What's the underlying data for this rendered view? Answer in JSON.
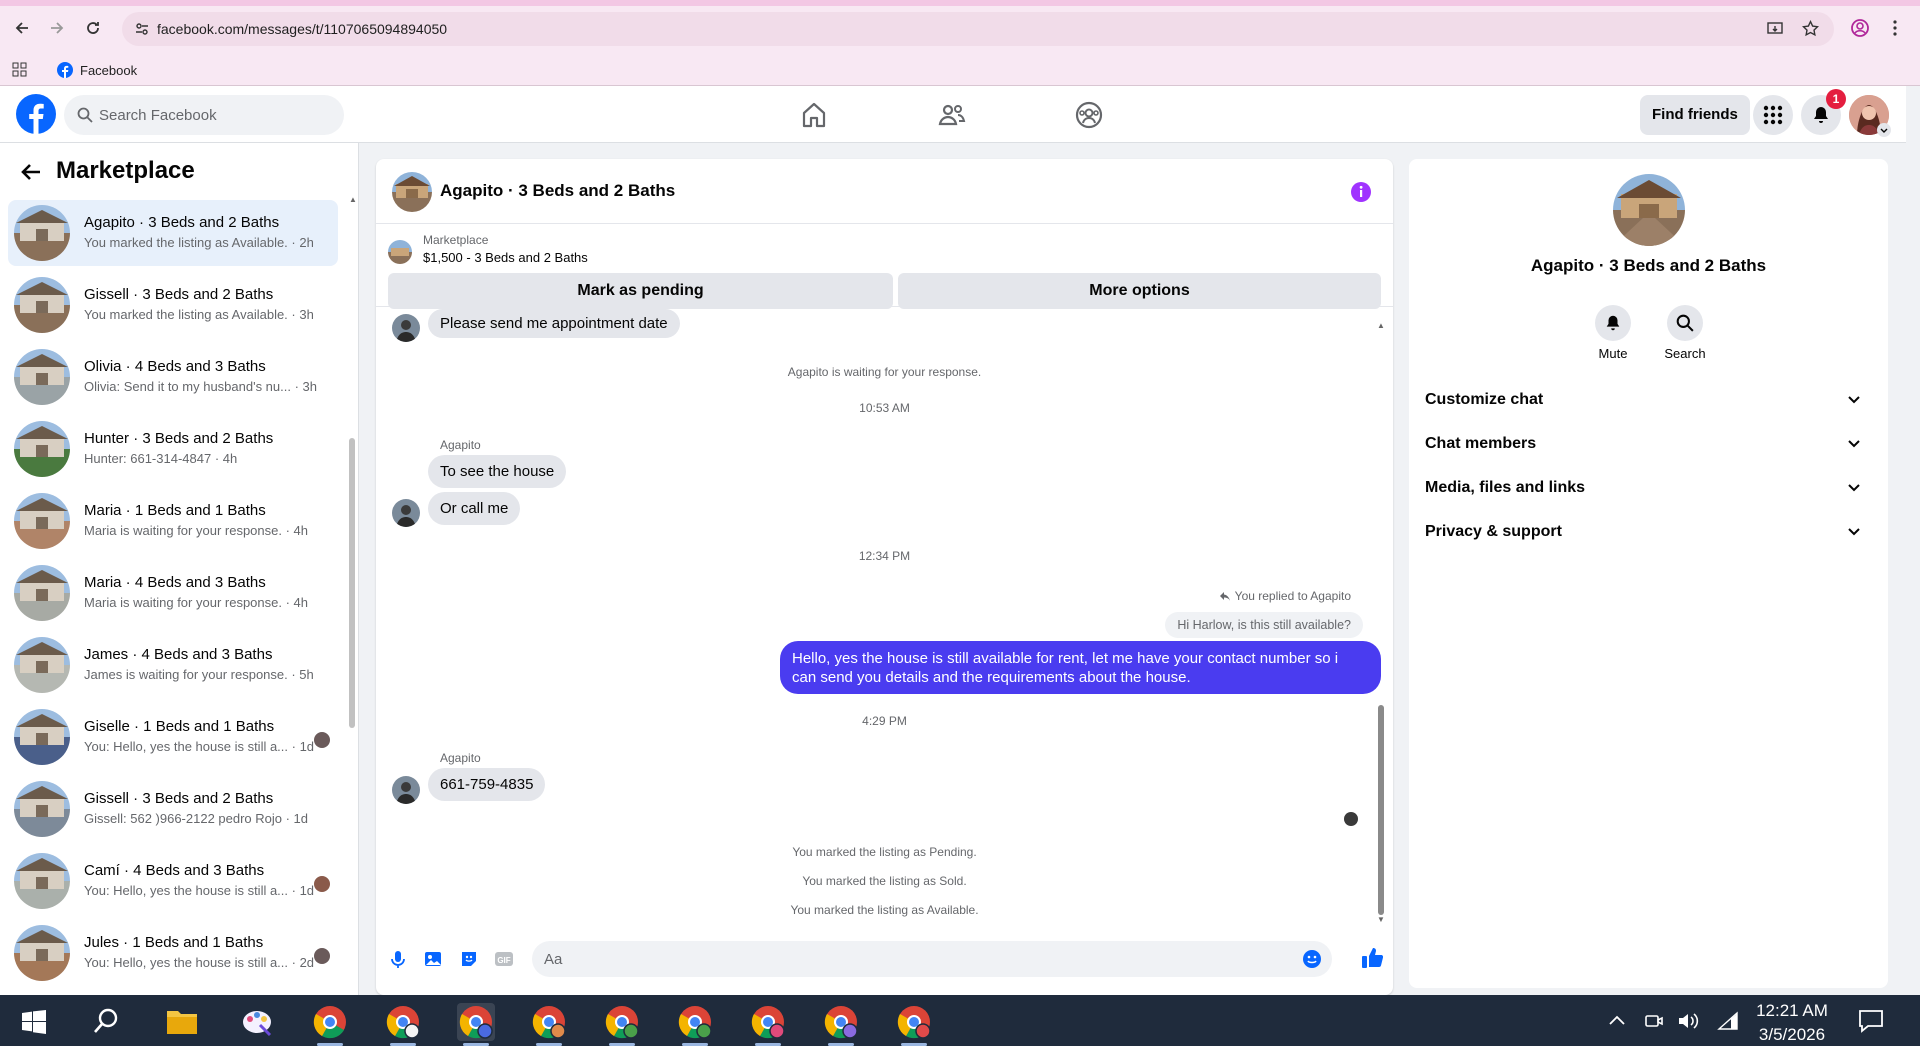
{
  "browser": {
    "url": "facebook.com/messages/t/1107065094894050",
    "bookmark": "Facebook"
  },
  "header": {
    "search_placeholder": "Search Facebook",
    "find_friends": "Find friends",
    "notification_count": "1"
  },
  "left_panel": {
    "title": "Marketplace",
    "conversations": [
      {
        "name": "Agapito · 3 Beds and 2 Baths",
        "sub": "You marked the listing as Available. · 2h",
        "active": true,
        "thumb": "#8a7059"
      },
      {
        "name": "Gissell · 3 Beds and 2 Baths",
        "sub": "You marked the listing as Available. · 3h",
        "thumb": "#8a7059"
      },
      {
        "name": "Olivia · 4 Beds and 3 Baths",
        "sub": "Olivia: Send it to my husband's nu...  · 3h",
        "thumb": "#9aa3a6"
      },
      {
        "name": "Hunter · 3 Beds and 2 Baths",
        "sub": "Hunter: 661-314-4847 · 4h",
        "thumb": "#4a7a3f"
      },
      {
        "name": "Maria · 1 Beds and 1 Baths",
        "sub": "Maria is waiting for your response. · 4h",
        "thumb": "#b08468"
      },
      {
        "name": "Maria · 4 Beds and 3 Baths",
        "sub": "Maria is waiting for your response. · 4h",
        "thumb": "#a7aaa4"
      },
      {
        "name": "James · 4 Beds and 3 Baths",
        "sub": "James is waiting for your response. · 5h",
        "thumb": "#b5b8b2"
      },
      {
        "name": "Giselle · 1 Beds and 1 Baths",
        "sub": "You: Hello, yes the house is still a... · 1d",
        "thumb": "#4a5f8a"
      },
      {
        "name": "Gissell · 3 Beds and 2 Baths",
        "sub": "Gissell: 562 )966-2122 pedro Rojo · 1d",
        "thumb": "#7d8a99"
      },
      {
        "name": "Camí · 4 Beds and 3 Baths",
        "sub": "You: Hello, yes the house is still a... · 1d",
        "thumb": "#aab0ab"
      },
      {
        "name": "Jules · 1 Beds and 1 Baths",
        "sub": "You: Hello, yes the house is still a... · 2d",
        "thumb": "#a47858"
      }
    ]
  },
  "chat": {
    "title": "Agapito · 3 Beds and 2 Baths",
    "listing_source": "Marketplace",
    "listing_title": "$1,500 - 3 Beds and 2 Baths",
    "mark_pending": "Mark as pending",
    "more_options": "More options",
    "msg_top": "Please send me appointment date",
    "waiting": "Agapito is waiting for your response.",
    "time1": "10:53 AM",
    "sender1": "Agapito",
    "msg1": "To see the house",
    "msg2": "Or call me",
    "time2": "12:34 PM",
    "replied_to": "You replied to Agapito",
    "quoted": "Hi Harlow, is this still available?",
    "my_msg_line1": "Hello, yes the house is still available for rent, let me have your contact number so i",
    "my_msg_line2": "can send you details and the requirements about the house.",
    "time3": "4:29 PM",
    "sender2": "Agapito",
    "msg3": "661-759-4835",
    "sys1": "You marked the listing as Pending.",
    "sys2": "You marked the listing as Sold.",
    "sys3": "You marked the listing as Available.",
    "composer_placeholder": "Aa"
  },
  "right_panel": {
    "title": "Agapito · 3 Beds and 2 Baths",
    "mute": "Mute",
    "search": "Search",
    "sections": [
      "Customize chat",
      "Chat members",
      "Media, files and links",
      "Privacy & support"
    ]
  },
  "taskbar": {
    "time": "12:21 AM",
    "date": "3/5/2026"
  },
  "colors": {
    "fb_blue": "#0866ff",
    "my_bubble": "#4a3cf0",
    "info_purple": "#a033ff",
    "badge_red": "#e41e3f"
  }
}
